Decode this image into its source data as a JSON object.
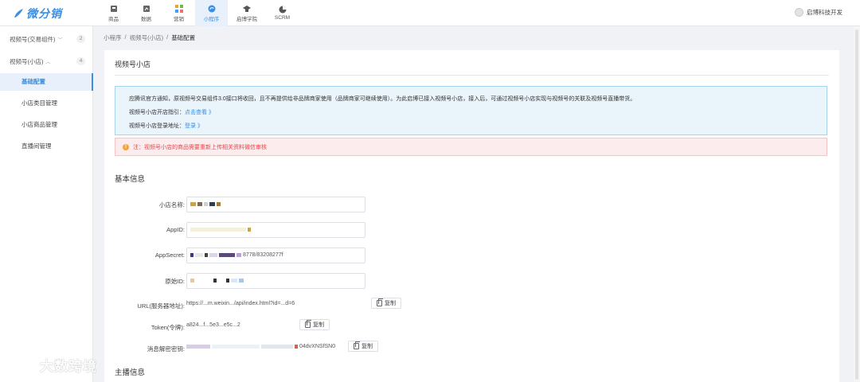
{
  "brand": {
    "logo_text": "微分销",
    "color": "#3a8ee6"
  },
  "nav": [
    {
      "label": "商品",
      "icon": "goods-icon"
    },
    {
      "label": "数据",
      "icon": "data-icon"
    },
    {
      "label": "营销",
      "icon": "marketing-icon"
    },
    {
      "label": "小程序",
      "icon": "mini-program-icon",
      "active": true
    },
    {
      "label": "启博学院",
      "icon": "academy-icon"
    },
    {
      "label": "SCRM",
      "icon": "scrm-icon"
    }
  ],
  "user": {
    "name": "启博科技开发"
  },
  "sidebar": {
    "groups": [
      {
        "label": "视频号(交易组件)",
        "count": "2",
        "caret": "﹀"
      },
      {
        "label": "视频号(小店)",
        "count": "4",
        "caret": "︿"
      }
    ],
    "items": [
      {
        "label": "基础配置"
      },
      {
        "label": "小店类目管理"
      },
      {
        "label": "小店商品管理"
      },
      {
        "label": "直播间管理"
      }
    ]
  },
  "breadcrumb": {
    "items": [
      "小程序",
      "视频号(小店)",
      "基础配置"
    ],
    "sep": "/"
  },
  "panel": {
    "title": "视频号小店"
  },
  "info": {
    "line1": "应腾讯官方通知，原视频号交易组件3.0接口将收回，且不再提供给非品牌商家使用（品牌商家可继续使用）。为此启博已接入视频号小店，接入后，可通过视频号小店实现与视频号的关联及视频号直播带货。",
    "line2_label": "视频号小店开店指引：",
    "line2_link": "点击查看 》",
    "line3_label": "视频号小店登录地址：",
    "line3_link": "登录 》"
  },
  "warning": {
    "icon": "!",
    "text": "注：视频号小店的商品需要重新上传相关资料微信审核"
  },
  "basic": {
    "title": "基本信息",
    "fields": [
      {
        "label": "小店名称:"
      },
      {
        "label": "AppID:"
      },
      {
        "label": "AppSecret:",
        "value_tail": "8778/83208277f"
      },
      {
        "label": "原始ID:"
      },
      {
        "label": "URL(服务器地址):",
        "value": "https://...m.weixin.../api/index.html?id=...d=6"
      },
      {
        "label": "Token(令牌):",
        "value": "a824...f...5e3...e5c...2"
      },
      {
        "label": "消息解密密钥:",
        "value_tail": "04dvXNSfSN0"
      }
    ],
    "copy_label": "复制"
  },
  "anchor": {
    "title": "主播信息"
  },
  "watermark": {
    "text": "大数跨境"
  }
}
